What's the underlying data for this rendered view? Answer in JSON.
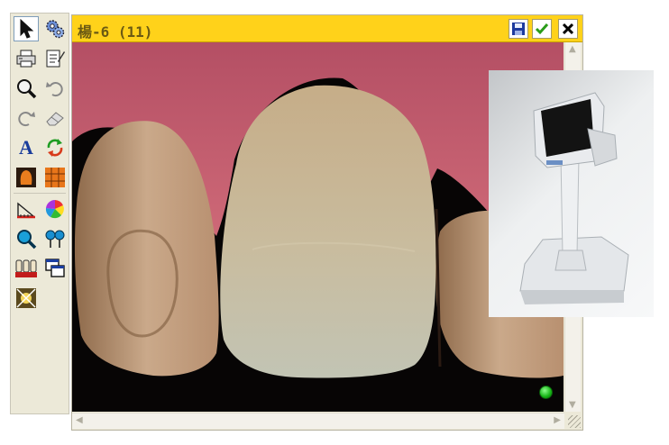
{
  "window": {
    "title": "楊-6 (11)"
  },
  "palette": {
    "tools": [
      {
        "name": "pointer-tool-button",
        "icon": "pointer-icon",
        "selected": true
      },
      {
        "name": "settings-tool-button",
        "icon": "gears-icon",
        "selected": false
      },
      {
        "name": "print-tool-button",
        "icon": "printer-icon",
        "selected": false
      },
      {
        "name": "document-tool-button",
        "icon": "document-edit-icon",
        "selected": false
      },
      {
        "name": "zoom-tool-button",
        "icon": "magnifier-icon",
        "selected": false
      },
      {
        "name": "undo-tool-button",
        "icon": "undo-icon",
        "selected": false
      },
      {
        "name": "redo-tool-button",
        "icon": "redo-icon",
        "selected": false
      },
      {
        "name": "eraser-tool-button",
        "icon": "eraser-icon",
        "selected": false
      },
      {
        "name": "text-tool-button",
        "icon": "text-a-icon",
        "selected": false
      },
      {
        "name": "refresh-tool-button",
        "icon": "refresh-icon",
        "selected": false
      },
      {
        "name": "tooth-map-tool-button",
        "icon": "tooth-shade-icon",
        "selected": false
      },
      {
        "name": "grid-tool-button",
        "icon": "grid-icon",
        "selected": false
      },
      {
        "name": "measure-tool-button",
        "icon": "ruler-icon",
        "selected": false
      },
      {
        "name": "color-wheel-tool-button",
        "icon": "color-wheel-icon",
        "selected": false
      },
      {
        "name": "find-tool-button",
        "icon": "magnifier-blue-icon",
        "selected": false
      },
      {
        "name": "pins-tool-button",
        "icon": "pins-icon",
        "selected": false
      },
      {
        "name": "shade-tabs-tool-button",
        "icon": "shade-tabs-icon",
        "selected": false
      },
      {
        "name": "windows-tool-button",
        "icon": "windows-icon",
        "selected": false
      },
      {
        "name": "image-tool-button",
        "icon": "image-crossed-icon",
        "selected": false
      }
    ]
  },
  "titlebar_buttons": [
    {
      "name": "save-button",
      "icon": "floppy-disk-icon"
    },
    {
      "name": "confirm-button",
      "icon": "checkmark-icon"
    },
    {
      "name": "close-button",
      "icon": "close-icon"
    }
  ],
  "status_indicator": {
    "icon": "green-led-icon",
    "color": "#1fbf1f"
  },
  "colors": {
    "titlebar": "#ffd21a",
    "palette": "#ece9d8",
    "gum": "#c45a6c",
    "tooth": "#c9b596"
  }
}
